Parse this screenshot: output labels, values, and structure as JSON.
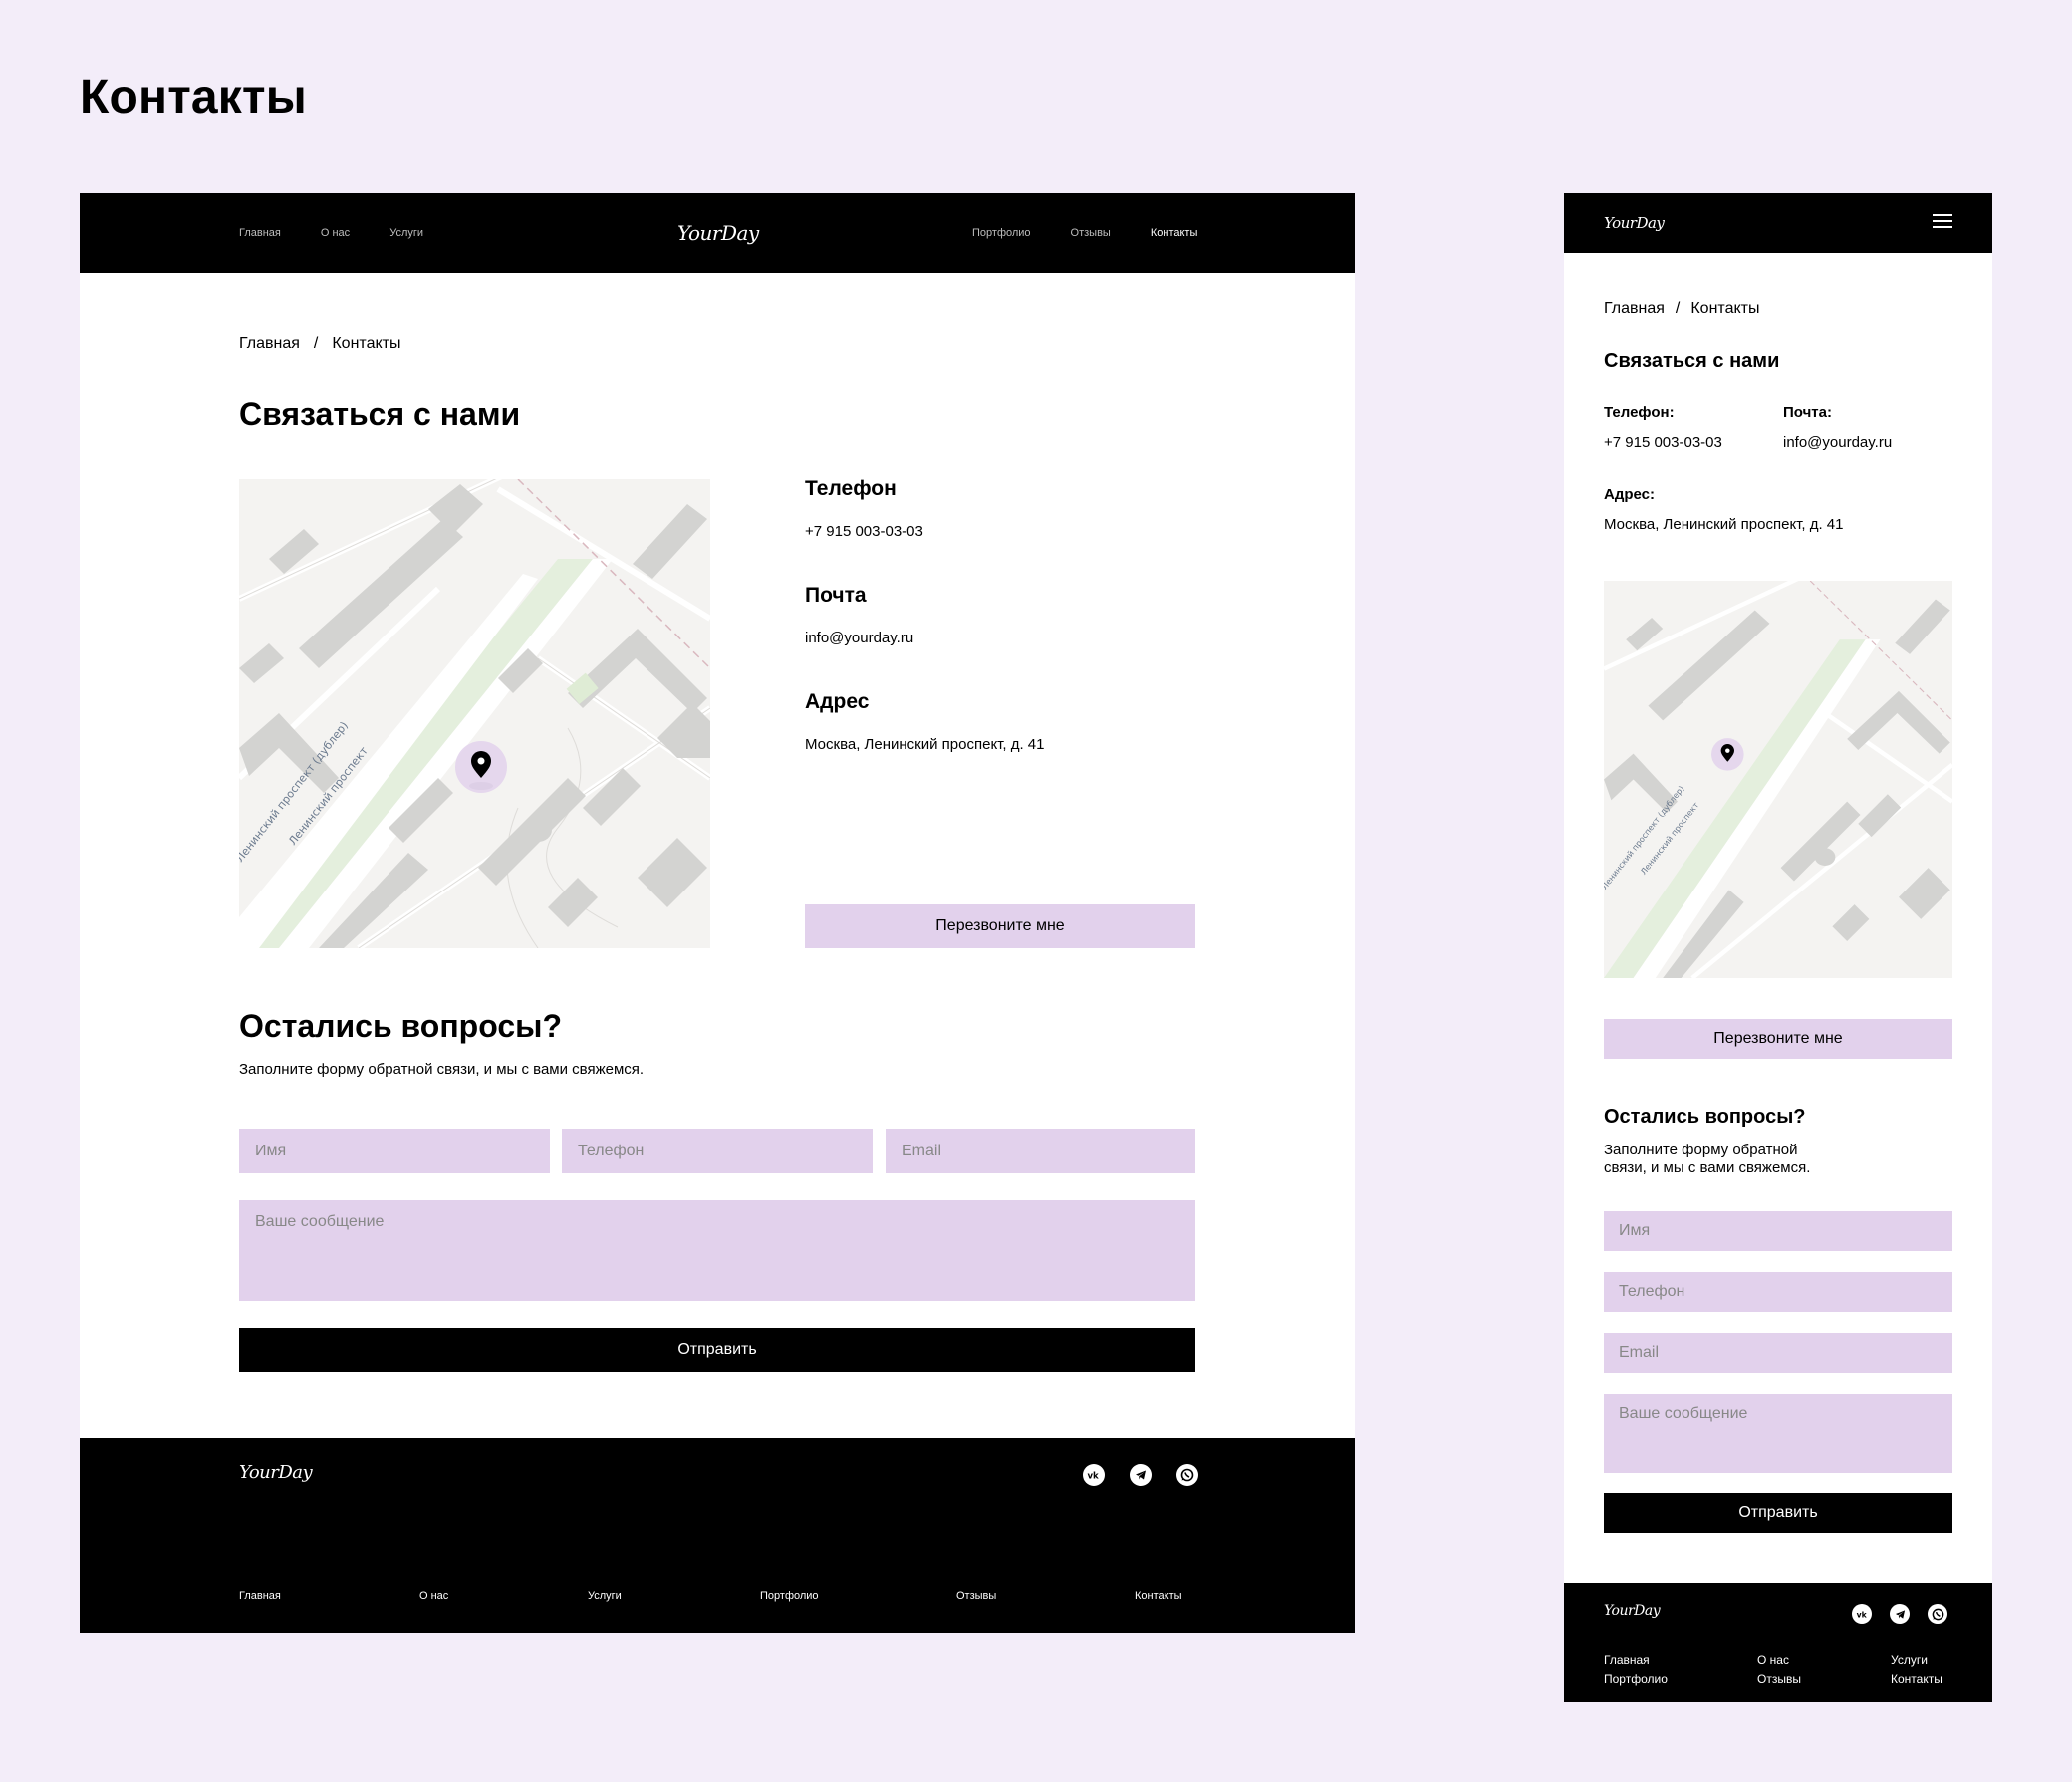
{
  "page_title": "Контакты",
  "brand": {
    "logo": "YourDay"
  },
  "desktop": {
    "nav_left": [
      "Главная",
      "О нас",
      "Услуги"
    ],
    "nav_right": [
      "Портфолио",
      "Отзывы",
      "Контакты"
    ],
    "breadcrumb": {
      "home": "Главная",
      "sep": "/",
      "current": "Контакты"
    },
    "heading": "Связаться с нами",
    "contacts": {
      "phone_label": "Телефон",
      "phone": "+7 915 003-03-03",
      "email_label": "Почта",
      "email": "info@yourday.ru",
      "address_label": "Адрес",
      "address": "Москва, Ленинский проспект, д. 41"
    },
    "callback_button": "Перезвоните мне",
    "form": {
      "heading": "Остались вопросы?",
      "subtitle": "Заполните форму обратной связи, и мы с вами свяжемся.",
      "name_placeholder": "Имя",
      "phone_placeholder": "Телефон",
      "email_placeholder": "Email",
      "message_placeholder": "Ваше сообщение",
      "submit": "Отправить"
    },
    "footer_nav": [
      "Главная",
      "О нас",
      "Услуги",
      "Портфолио",
      "Отзывы",
      "Контакты"
    ]
  },
  "mobile": {
    "breadcrumb": {
      "home": "Главная",
      "sep": "/",
      "current": "Контакты"
    },
    "heading": "Связаться с нами",
    "contacts": {
      "phone_label": "Телефон:",
      "phone": "+7 915 003-03-03",
      "email_label": "Почта:",
      "email": "info@yourday.ru",
      "address_label": "Адрес:",
      "address": "Москва, Ленинский проспект, д. 41"
    },
    "callback_button": "Перезвоните мне",
    "form": {
      "heading": "Остались вопросы?",
      "subtitle": "Заполните форму обратной связи, и мы с вами свяжемся.",
      "name_placeholder": "Имя",
      "phone_placeholder": "Телефон",
      "email_placeholder": "Email",
      "message_placeholder": "Ваше сообщение",
      "submit": "Отправить"
    },
    "footer_nav": [
      "Главная",
      "О нас",
      "Услуги",
      "Портфолио",
      "Отзывы",
      "Контакты"
    ]
  },
  "map": {
    "street_1": "Ленинский проспект",
    "street_2": "Ленинский проспект (дублер)"
  },
  "social_icons": [
    "vk-icon",
    "telegram-icon",
    "whatsapp-icon"
  ],
  "colors": {
    "background": "#f3edf9",
    "accent": "#e2d1ec",
    "dark": "#000000"
  }
}
